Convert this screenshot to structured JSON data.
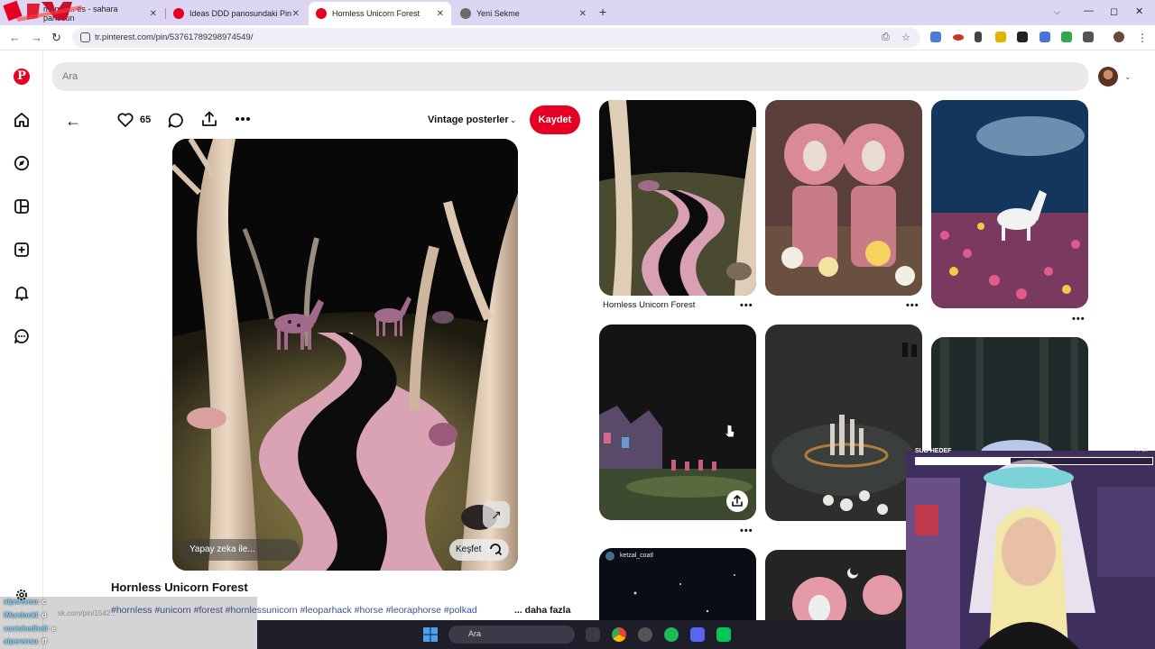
{
  "browser": {
    "tabs": [
      {
        "label": "meme ... es - sahara panosun",
        "active": false
      },
      {
        "label": "Ideas DDD panosundaki Pin",
        "active": false
      },
      {
        "label": "Hornless Unicorn Forest",
        "active": true
      },
      {
        "label": "Yeni Sekme",
        "active": false
      }
    ],
    "url": "tr.pinterest.com/pin/537617892989745​49/",
    "new_tab_symbol": "+",
    "close_symbol": "✕"
  },
  "search": {
    "placeholder": "Ara"
  },
  "pin": {
    "like_count": "65",
    "board_name": "Vintage posterler",
    "save_label": "Kaydet",
    "ai_label": "Yapay zeka ile...",
    "explore_label": "Keşfet",
    "title": "Hornless Unicorn Forest",
    "hashtags": "#hornless #unicorn #forest #hornlessunicorn #leoparhack #horse #leoraphorse #polkad",
    "more_label": "... daha fazla"
  },
  "grid": {
    "items": [
      {
        "caption": "Hornless Unicorn Forest"
      },
      {
        "caption": ""
      },
      {
        "caption": ""
      },
      {
        "caption": ""
      },
      {
        "caption": ""
      },
      {
        "caption": ""
      },
      {
        "caption": "ketzal_coatl"
      },
      {
        "caption": ""
      }
    ],
    "more_symbol": "•••"
  },
  "stream": {
    "subgoal_label": "SUB HEDEF",
    "subgoal_count": "4 / 10",
    "subgoal_progress": 0.4,
    "chat": [
      {
        "user": "alperensu",
        "msg": ": c"
      },
      {
        "user": "iMurdockl",
        "msg": ": d"
      },
      {
        "user": "vanishedhell",
        "msg": ": e"
      },
      {
        "user": "alperensu",
        "msg": ": ff"
      }
    ],
    "ghost_url": "sk.com/pin/1542..."
  },
  "taskbar": {
    "search_placeholder": "Ara"
  },
  "colors": {
    "accent": "#e60023",
    "tabstrip": "#ddd6f2",
    "hashtag": "#3d4f9a"
  },
  "icons": [
    "pinterest-icon",
    "home-icon",
    "explore-icon",
    "boards-icon",
    "create-icon",
    "bell-icon",
    "messages-icon",
    "settings-icon",
    "heart-icon",
    "comment-icon",
    "share-icon",
    "more-icon",
    "back-arrow-icon",
    "expand-icon",
    "lens-icon"
  ]
}
